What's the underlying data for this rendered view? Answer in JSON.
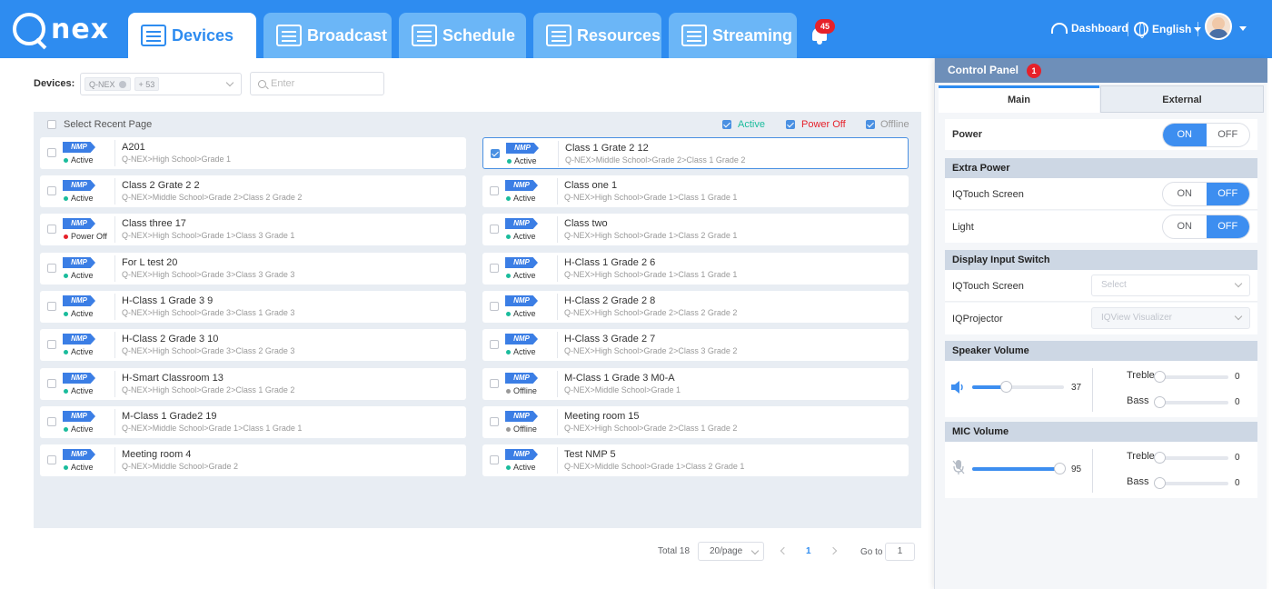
{
  "brand": {
    "name": "nex"
  },
  "nav": {
    "tabs": [
      {
        "label": "Devices",
        "icon": "devices-icon"
      },
      {
        "label": "Broadcast",
        "icon": "broadcast-icon"
      },
      {
        "label": "Schedule",
        "icon": "schedule-icon"
      },
      {
        "label": "Resources",
        "icon": "resources-icon"
      },
      {
        "label": "Streaming",
        "icon": "streaming-icon"
      }
    ],
    "notification_count": "45",
    "dashboard": "Dashboard",
    "language": "English"
  },
  "filters": {
    "devices_label": "Devices:",
    "tag": "Q-NEX",
    "more": "+ 53",
    "search_placeholder": "Enter"
  },
  "list": {
    "select_recent": "Select Recent Page",
    "legend": {
      "active": "Active",
      "power_off": "Power Off",
      "offline": "Offline"
    }
  },
  "colors": {
    "accent": "#2e8cf0",
    "active": "#1abc9c",
    "power_off": "#e6212a",
    "offline": "#999999"
  },
  "devices": [
    {
      "name": "A201",
      "path": "Q-NEX>High School>Grade 1",
      "status": "Active",
      "badge": "NMP",
      "selected": false
    },
    {
      "name": "Class 1 Grate 2 12",
      "path": "Q-NEX>Middle School>Grade 2>Class 1 Grade 2",
      "status": "Active",
      "badge": "NMP",
      "selected": true
    },
    {
      "name": "Class 2 Grate 2 2",
      "path": "Q-NEX>Middle School>Grade 2>Class 2 Grade 2",
      "status": "Active",
      "badge": "NMP",
      "selected": false
    },
    {
      "name": "Class one 1",
      "path": "Q-NEX>High School>Grade 1>Class 1 Grade 1",
      "status": "Active",
      "badge": "NMP",
      "selected": false
    },
    {
      "name": "Class three 17",
      "path": "Q-NEX>High School>Grade 1>Class 3 Grade 1",
      "status": "Power Off",
      "badge": "NMP",
      "selected": false
    },
    {
      "name": "Class two",
      "path": "Q-NEX>High School>Grade 1>Class 2 Grade 1",
      "status": "Active",
      "badge": "NMP",
      "selected": false
    },
    {
      "name": "For L test 20",
      "path": "Q-NEX>High School>Grade 3>Class 3 Grade 3",
      "status": "Active",
      "badge": "NMP",
      "selected": false
    },
    {
      "name": "H-Class 1 Grade 2 6",
      "path": "Q-NEX>High School>Grade 1>Class 1 Grade 1",
      "status": "Active",
      "badge": "NMP",
      "selected": false
    },
    {
      "name": "H-Class 1 Grade 3 9",
      "path": "Q-NEX>High School>Grade 3>Class 1 Grade 3",
      "status": "Active",
      "badge": "NMP",
      "selected": false
    },
    {
      "name": "H-Class 2 Grade 2 8",
      "path": "Q-NEX>High School>Grade 2>Class 2 Grade 2",
      "status": "Active",
      "badge": "NMP",
      "selected": false
    },
    {
      "name": "H-Class 2 Grade 3 10",
      "path": "Q-NEX>High School>Grade 3>Class 2 Grade 3",
      "status": "Active",
      "badge": "NMP",
      "selected": false
    },
    {
      "name": "H-Class 3 Grade 2 7",
      "path": "Q-NEX>High School>Grade 2>Class 3 Grade 2",
      "status": "Active",
      "badge": "NMP",
      "selected": false
    },
    {
      "name": "H-Smart Classroom 13",
      "path": "Q-NEX>High School>Grade 2>Class 1 Grade 2",
      "status": "Active",
      "badge": "NMP",
      "selected": false
    },
    {
      "name": "M-Class 1 Grade 3 M0-A",
      "path": "Q-NEX>Middle School>Grade 1",
      "status": "Offline",
      "badge": "NMP",
      "selected": false
    },
    {
      "name": "M-Class 1 Grade2 19",
      "path": "Q-NEX>Middle School>Grade 1>Class 1 Grade 1",
      "status": "Active",
      "badge": "NMP",
      "selected": false
    },
    {
      "name": "Meeting room 15",
      "path": "Q-NEX>High School>Grade 2>Class 1 Grade 2",
      "status": "Offline",
      "badge": "NMP",
      "selected": false
    },
    {
      "name": "Meeting room 4",
      "path": "Q-NEX>Middle School>Grade 2",
      "status": "Active",
      "badge": "NMP",
      "selected": false
    },
    {
      "name": "Test NMP 5",
      "path": "Q-NEX>Middle School>Grade 1>Class 2 Grade 1",
      "status": "Active",
      "badge": "NMP",
      "selected": false
    }
  ],
  "pagination": {
    "total": "Total 18",
    "page_size": "20/page",
    "current": "1",
    "goto_label": "Go to",
    "goto_value": "1"
  },
  "control_panel": {
    "title": "Control Panel",
    "badge": "1",
    "tabs": {
      "main": "Main",
      "external": "External"
    },
    "power": {
      "label": "Power",
      "on": "ON",
      "off": "OFF",
      "state": "ON"
    },
    "extra_power": {
      "title": "Extra Power",
      "items": [
        {
          "label": "IQTouch Screen",
          "on": "ON",
          "off": "OFF",
          "state": "OFF"
        },
        {
          "label": "Light",
          "on": "ON",
          "off": "OFF",
          "state": "OFF"
        }
      ]
    },
    "display_input": {
      "title": "Display Input Switch",
      "items": [
        {
          "label": "IQTouch Screen",
          "value": "Select"
        },
        {
          "label": "IQProjector",
          "value": "IQView Visualizer"
        }
      ]
    },
    "speaker": {
      "title": "Speaker Volume",
      "volume": 37,
      "treble_label": "Treble",
      "treble": 0,
      "bass_label": "Bass",
      "bass": 0
    },
    "mic": {
      "title": "MIC Volume",
      "volume": 95,
      "treble_label": "Treble",
      "treble": 0,
      "bass_label": "Bass",
      "bass": 0
    }
  }
}
